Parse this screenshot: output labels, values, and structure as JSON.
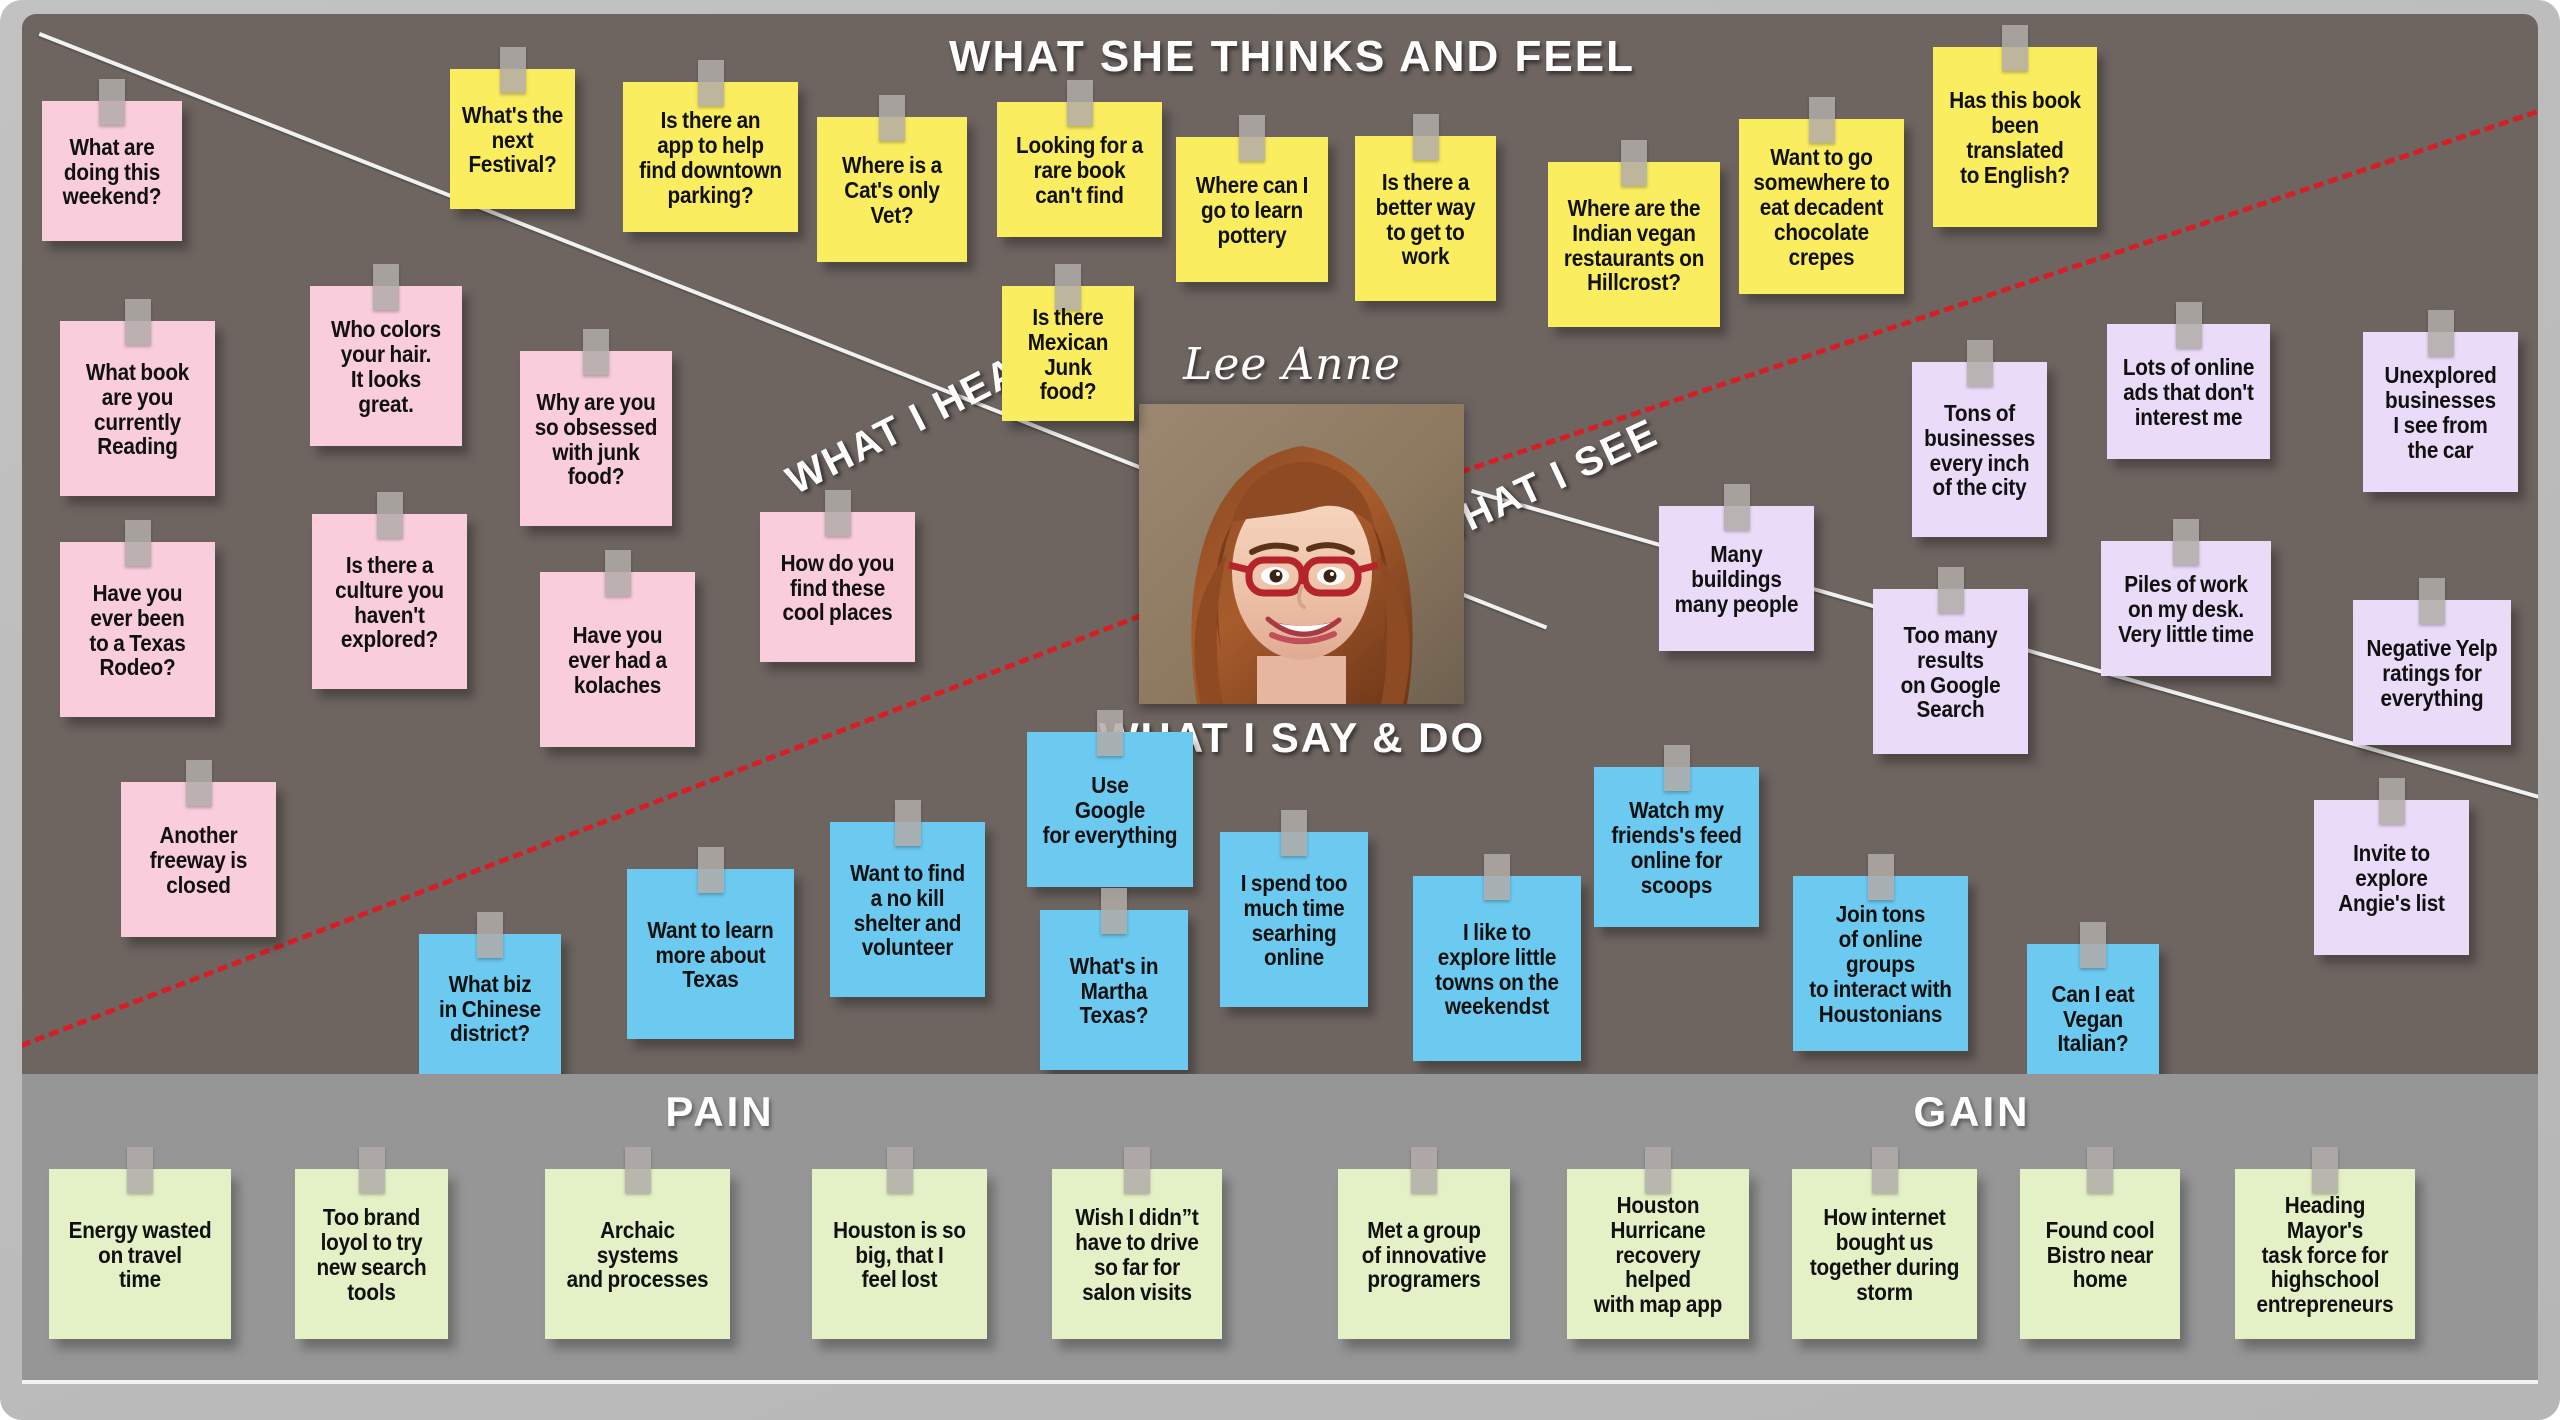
{
  "board": {
    "persona_name": "Lee Anne",
    "quadrants": {
      "think": "WHAT SHE THINKS AND FEEL",
      "hear": "WHAT I HEAR",
      "see": "WHAT I SEE",
      "say": "WHAT I SAY & DO",
      "pain": "PAIN",
      "gain": "GAIN"
    },
    "colors": {
      "think_note": "#faed5f",
      "hear_note": "#f9cddc",
      "see_note": "#eadcf8",
      "say_note": "#6cc9ef",
      "paingain_note": "#e4f0c5",
      "canvas": "#6e6561",
      "paingain_band": "#969696",
      "divider_white": "#f1f1f1",
      "divider_red": "#d41f26"
    }
  },
  "notes": {
    "think": [
      "What's the\nnext\nFestival?",
      "Is there an\napp to help\nfind downtown\nparking?",
      "Where is a\nCat's only\nVet?",
      "Looking for a\nrare book\ncan't find",
      "Is there\nMexican\nJunk food?",
      "Where can I\ngo to learn\npottery",
      "Is there a\nbetter way\nto get to\nwork",
      "Where are the\nIndian vegan\nrestaurants on\nHillcrost?",
      "Want to go\nsomewhere to\neat decadent\nchocolate\ncrepes",
      "Has this book\nbeen\ntranslated\nto English?"
    ],
    "hear": [
      "What are\ndoing this\nweekend?",
      "What book\nare you\ncurrently\nReading",
      "Who colors\nyour hair.\nIt looks\ngreat.",
      "Why are you\nso obsessed\nwith junk\nfood?",
      "Is there a\nculture you\nhaven't\nexplored?",
      "Have you\never been\nto a Texas\nRodeo?",
      "Have you\never had a\nkolaches",
      "How do you\nfind these\ncool places",
      "Another\nfreeway is\nclosed"
    ],
    "see": [
      "Lots of online\nads that don't\ninterest me",
      "Unexplored\nbusinesses\nI see from\nthe car",
      "Tons of\nbusinesses\nevery inch\nof the city",
      "Many\nbuildings\nmany people",
      "Too many\nresults\non Google\nSearch",
      "Piles of work\non my desk.\nVery little time",
      "Negative Yelp\nratings for\neverything",
      "Invite to\nexplore\nAngie's list"
    ],
    "say": [
      "Use\nGoogle\nfor everything",
      "What's in\nMartha\nTexas?",
      "I spend too\nmuch time\nsearhing\nonline",
      "I like to\nexplore little\ntowns on the\nweekendst",
      "Watch my\nfriends's feed\nonline for\nscoops",
      "Join tons\nof online groups\nto interact with\nHoustonians",
      "Can I eat\nVegan\nItalian?",
      "Want to learn\nmore about\nTexas",
      "Want to find\na no kill\nshelter and\nvolunteer",
      "What biz\nin Chinese\ndistrict?"
    ],
    "pain": [
      "Energy wasted\non travel\ntime",
      "Too brand\nloyol to try\nnew search\ntools",
      "Archaic\nsystems\nand processes",
      "Houston is so\nbig, that I\nfeel lost",
      "Wish I didn”t\nhave to drive\nso far for\nsalon visits"
    ],
    "gain": [
      "Met a group\nof innovative\nprogramers",
      "Houston\nHurricane\nrecovery helped\nwith map app",
      "How internet\nbought us\ntogether during\nstorm",
      "Found cool\nBistro near\nhome",
      "Heading Mayor's\ntask force for\nhighschool\nentrepreneurs"
    ]
  }
}
